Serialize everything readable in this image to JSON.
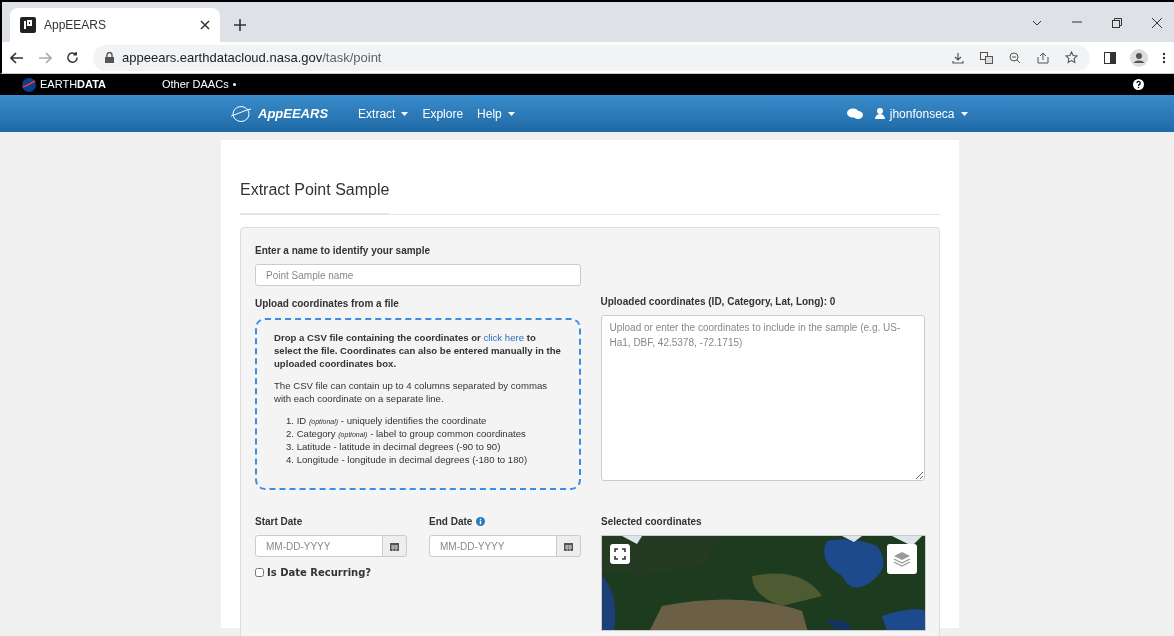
{
  "browser": {
    "tab_title": "AppEEARS",
    "address_host": "appeears.earthdatacloud.nasa.gov",
    "address_path": "/task/point"
  },
  "earthdata_bar": {
    "brand": "EARTH**DATA**",
    "menu": "Other DAACs"
  },
  "navbar": {
    "brand": "AppEEARS",
    "items": [
      {
        "label": "Extract",
        "dropdown": true
      },
      {
        "label": "Explore",
        "dropdown": false
      },
      {
        "label": "Help",
        "dropdown": true
      }
    ],
    "user": "jhonfonseca"
  },
  "page_title": "Extract Point Sample",
  "form": {
    "name_label": "Enter a name to identify your sample",
    "name_placeholder": "Point Sample name",
    "upload_label": "Upload coordinates from a file",
    "dropzone": {
      "intro_before": "Drop a CSV file containing the coordinates or",
      "link": "click here",
      "intro_after": "to select the file. Coordinates can also be entered manually in the uploaded coordinates box.",
      "note": "The CSV file can contain up to 4 columns separated by commas with each coordinate on a separate line.",
      "columns": [
        {
          "number": "1.",
          "name": "ID",
          "optional": "(optional)",
          "text": "- uniquely identifies the coordinate"
        },
        {
          "number": "2.",
          "name": "Category",
          "optional": "(optional)",
          "text": "- label to group common coordinates"
        },
        {
          "number": "3.",
          "name": "Latitude",
          "text": "- latitude in decimal degrees (-90 to 90)"
        },
        {
          "number": "4.",
          "name": "Longitude",
          "text": "- longitude in decimal degrees (-180 to 180)"
        }
      ]
    },
    "coordinates": {
      "label": "Uploaded coordinates (ID, Category, Lat, Long): 0",
      "placeholder": "Upload or enter the coordinates to include in the sample (e.g. US-Ha1, DBF, 42.5378, -72.1715)"
    },
    "dates": [
      {
        "label": "Start Date",
        "placeholder": "MM-DD-YYYY",
        "info": false
      },
      {
        "label": "End Date",
        "placeholder": "MM-DD-YYYY",
        "info": true
      }
    ],
    "recurring": {
      "label": "Is Date Recurring?",
      "checked": false
    },
    "map": {
      "label": "Selected coordinates"
    }
  }
}
